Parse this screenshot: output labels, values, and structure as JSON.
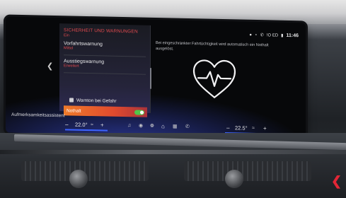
{
  "settings_panel": {
    "title": "SICHERHEIT UND WARNUNGEN",
    "status": "Ein",
    "items": [
      {
        "label": "Vorfahrtswarnung",
        "value": "Mittel"
      },
      {
        "label": "Ausstiegswarnung",
        "value": "Erweitert"
      }
    ],
    "sub_item": "Warnton bei Gefahr",
    "nothalt_label": "Nothalt",
    "nothalt_on": true,
    "last_item": "Aufmerksamkeitsassistent"
  },
  "info": {
    "text": "Bei eingeschränkter Fahrtüchtigkeit wird automatisch ein Nothalt ausgelöst."
  },
  "statusbar": {
    "icons": [
      "user-icon",
      "bluetooth-icon",
      "phone-icon",
      "sos-icon",
      "mute-icon",
      "signal-icon"
    ],
    "text": "!O ED",
    "time": "11:46"
  },
  "climate": {
    "left_temp": "22.0",
    "right_temp": "22.5",
    "unit": "°",
    "minus": "–",
    "plus": "+"
  },
  "colors": {
    "accent": "#e14a4f",
    "highlight": "#ee7a2a",
    "toggle": "#51c64a",
    "temp_bar": "#3d64ff"
  }
}
